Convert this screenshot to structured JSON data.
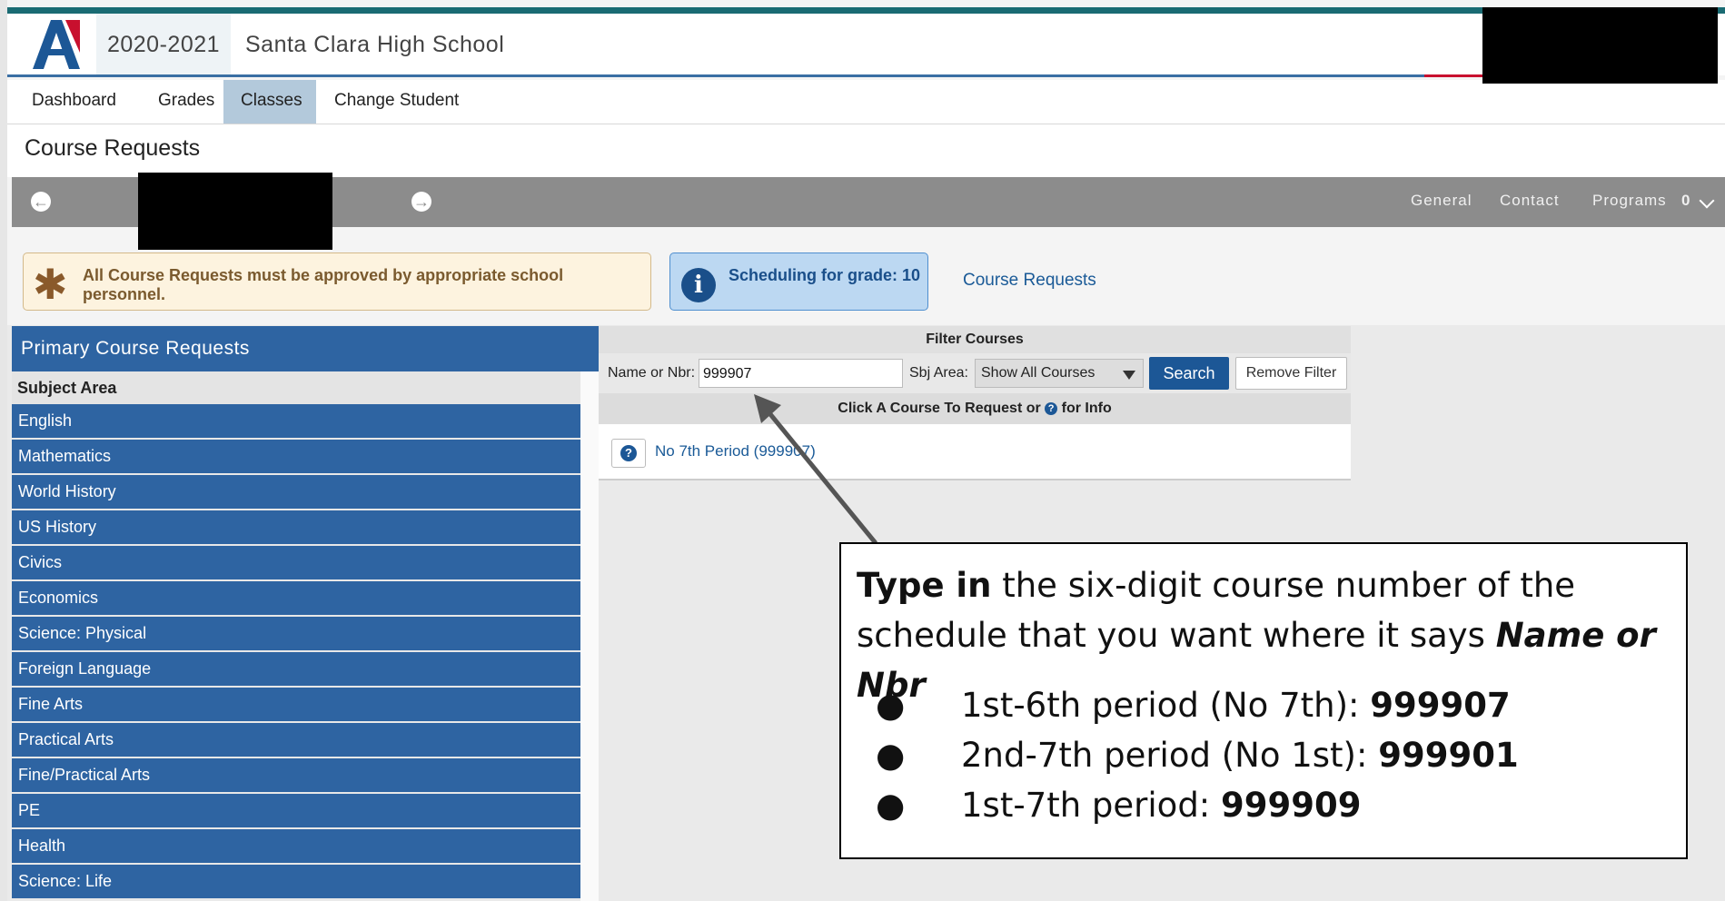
{
  "header": {
    "year": "2020-2021",
    "school": "Santa Clara High School",
    "logo_letter": "A"
  },
  "nav": {
    "items": [
      {
        "label": "Dashboard"
      },
      {
        "label": "Grades"
      },
      {
        "label": "Classes",
        "active": true
      },
      {
        "label": "Change Student"
      }
    ]
  },
  "page": {
    "title": "Course Requests"
  },
  "student_bar": {
    "links": [
      "General",
      "Contact",
      "Programs"
    ],
    "programs_count": "0"
  },
  "notice": {
    "text": "All Course Requests must be approved by appropriate school personnel."
  },
  "scheduling": {
    "text": "Scheduling for grade: 10"
  },
  "course_requests_link": "Course Requests",
  "primary": {
    "title": "Primary Course Requests",
    "subject_header": "Subject Area",
    "subjects": [
      "English",
      "Mathematics",
      "World History",
      "US History",
      "Civics",
      "Economics",
      "Science: Physical",
      "Foreign Language",
      "Fine Arts",
      "Practical Arts",
      "Fine/Practical Arts",
      "PE",
      "Health",
      "Science: Life"
    ]
  },
  "filter": {
    "title": "Filter Courses",
    "name_label": "Name or Nbr:",
    "name_value": "999907",
    "sbj_label": "Sbj Area:",
    "sbj_value": "Show All Courses",
    "search_label": "Search",
    "remove_label": "Remove Filter",
    "click_text_pre": "Click A Course To Request or",
    "click_text_post": "for Info",
    "result": "No 7th Period (999907)"
  },
  "callout": {
    "line1_bold": "Type in",
    "line1_rest": " the six-digit course number of the schedule that you want where it says ",
    "line1_italic": "Name or Nbr",
    "items": [
      {
        "text": "1st-6th period (No 7th): ",
        "code": "999907"
      },
      {
        "text": "2nd-7th period (No 1st): ",
        "code": "999901"
      },
      {
        "text": "1st-7th period: ",
        "code": "999909"
      }
    ]
  },
  "colors": {
    "accent_blue": "#2e64a2",
    "button_blue": "#1c5796",
    "teal_strip": "#1a6b73",
    "notice_bg": "#fdf3df",
    "info_bg": "#bcd8f2"
  }
}
